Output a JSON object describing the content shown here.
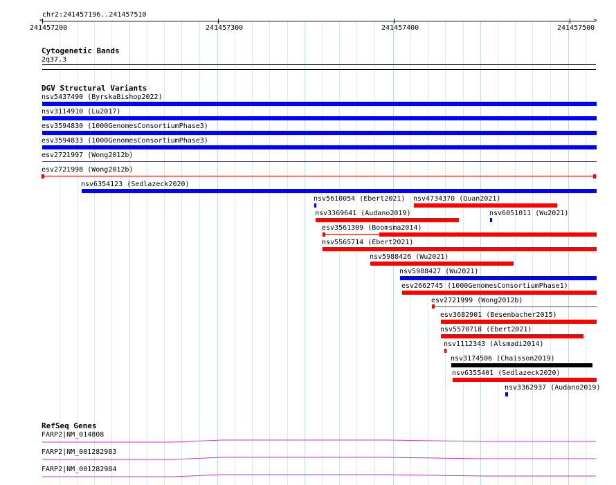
{
  "ruler": {
    "location": "chr2:241457196..241457510",
    "ticks": [
      "241457200",
      "241457300",
      "241457400",
      "241457500"
    ]
  },
  "cytoband": {
    "title": "Cytogenetic Bands",
    "band": "2q37.3"
  },
  "dgv": {
    "title": "DGV Structural Variants",
    "features": [
      {
        "label": "nsv5437490 (ByrskaBishop2022)",
        "color": "#0000ff"
      },
      {
        "label": "nsv3114910 (Lu2017)",
        "color": "#0000ff"
      },
      {
        "label": "esv3594830 (1000GenomesConsortiumPhase3)",
        "color": "#0000ff"
      },
      {
        "label": "esv3594833 (1000GenomesConsortiumPhase3)",
        "color": "#0000ff"
      },
      {
        "label": "esv2721997 (Wong2012b)",
        "color": "#ff0000"
      },
      {
        "label": "esv2721998 (Wong2012b)",
        "color": "#ff0000"
      },
      {
        "label": "nsv6354123 (Sedlazeck2020)",
        "color": "#0000ff"
      },
      {
        "label": "nsv5610054 (Ebert2021)",
        "color": "#0000ff"
      },
      {
        "label": "nsv4734370 (Quan2021)",
        "color": "#ff0000"
      },
      {
        "label": "nsv3369641 (Audano2019)",
        "color": "#ff0000"
      },
      {
        "label": "nsv6051011 (Wu2021)",
        "color": "#0000ff"
      },
      {
        "label": "esv3561309 (Boomsma2014)",
        "color": "#ff0000"
      },
      {
        "label": "nsv5565714 (Ebert2021)",
        "color": "#ff0000"
      },
      {
        "label": "nsv5988426 (Wu2021)",
        "color": "#ff0000"
      },
      {
        "label": "nsv5988427 (Wu2021)",
        "color": "#0000ff"
      },
      {
        "label": "esv2662745 (1000GenomesConsortiumPhase1)",
        "color": "#ff0000"
      },
      {
        "label": "esv2721999 (Wong2012b)",
        "color": "#ff0000"
      },
      {
        "label": "esv3682901 (Besenbacher2015)",
        "color": "#ff0000"
      },
      {
        "label": "nsv5570718 (Ebert2021)",
        "color": "#ff0000"
      },
      {
        "label": "nsv1112343 (Alsmadi2014)",
        "color": "#ff0000"
      },
      {
        "label": "nsv3174506 (Chaisson2019)",
        "color": "#000000"
      },
      {
        "label": "nsv6355401 (Sedlazeck2020)",
        "color": "#ff0000"
      },
      {
        "label": "nsv3362937 (Audano2019)",
        "color": "#0000ff"
      }
    ]
  },
  "refseq": {
    "title": "RefSeq Genes",
    "genes": [
      {
        "label": "FARP2|NM_014808",
        "color": "#cc33cc"
      },
      {
        "label": "FARP2|NM_001282983",
        "color": "#cc33cc"
      },
      {
        "label": "FARP2|NM_001282984",
        "color": "#cc33cc"
      }
    ]
  }
}
